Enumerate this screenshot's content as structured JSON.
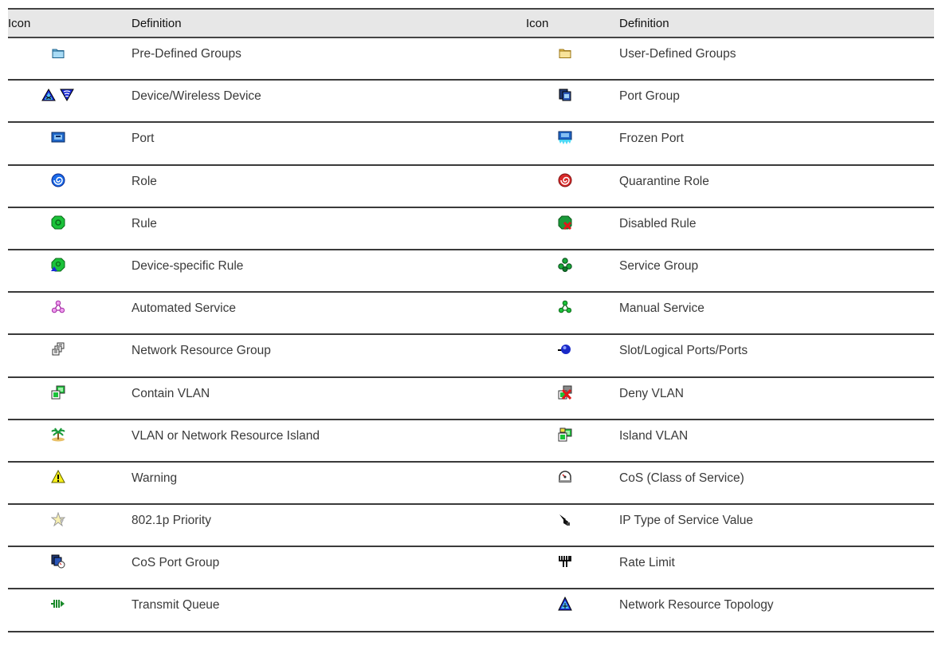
{
  "headers": {
    "icon": "Icon",
    "definition": "Definition"
  },
  "rows": [
    {
      "left": {
        "icon": "pre-defined-groups-icon",
        "label": "Pre-Defined Groups"
      },
      "right": {
        "icon": "user-defined-groups-icon",
        "label": "User-Defined Groups"
      }
    },
    {
      "left": {
        "icon": "device-wireless-device-icon",
        "label": "Device/Wireless Device"
      },
      "right": {
        "icon": "port-group-icon",
        "label": "Port Group"
      }
    },
    {
      "left": {
        "icon": "port-icon",
        "label": "Port"
      },
      "right": {
        "icon": "frozen-port-icon",
        "label": "Frozen Port"
      }
    },
    {
      "left": {
        "icon": "role-icon",
        "label": "Role"
      },
      "right": {
        "icon": "quarantine-role-icon",
        "label": "Quarantine Role"
      }
    },
    {
      "left": {
        "icon": "rule-icon",
        "label": "Rule"
      },
      "right": {
        "icon": "disabled-rule-icon",
        "label": "Disabled Rule"
      }
    },
    {
      "left": {
        "icon": "device-specific-rule-icon",
        "label": "Device-specific Rule"
      },
      "right": {
        "icon": "service-group-icon",
        "label": "Service Group"
      }
    },
    {
      "left": {
        "icon": "automated-service-icon",
        "label": "Automated Service"
      },
      "right": {
        "icon": "manual-service-icon",
        "label": "Manual Service"
      }
    },
    {
      "left": {
        "icon": "network-resource-group-icon",
        "label": "Network Resource Group"
      },
      "right": {
        "icon": "slot-logical-ports-icon",
        "label": "Slot/Logical Ports/Ports"
      }
    },
    {
      "left": {
        "icon": "contain-vlan-icon",
        "label": "Contain VLAN"
      },
      "right": {
        "icon": "deny-vlan-icon",
        "label": "Deny VLAN"
      }
    },
    {
      "left": {
        "icon": "vlan-island-icon",
        "label": "VLAN or Network Resource Island"
      },
      "right": {
        "icon": "island-vlan-icon",
        "label": "Island VLAN"
      }
    },
    {
      "left": {
        "icon": "warning-icon",
        "label": "Warning"
      },
      "right": {
        "icon": "cos-icon",
        "label": "CoS (Class of Service)"
      }
    },
    {
      "left": {
        "icon": "priority-802-1p-icon",
        "label": "802.1p Priority"
      },
      "right": {
        "icon": "ip-tos-value-icon",
        "label": "IP Type of Service Value"
      }
    },
    {
      "left": {
        "icon": "cos-port-group-icon",
        "label": "CoS Port Group"
      },
      "right": {
        "icon": "rate-limit-icon",
        "label": "Rate Limit"
      }
    },
    {
      "left": {
        "icon": "transmit-queue-icon",
        "label": "Transmit Queue"
      },
      "right": {
        "icon": "network-resource-topology-icon",
        "label": "Network Resource Topology"
      }
    }
  ]
}
